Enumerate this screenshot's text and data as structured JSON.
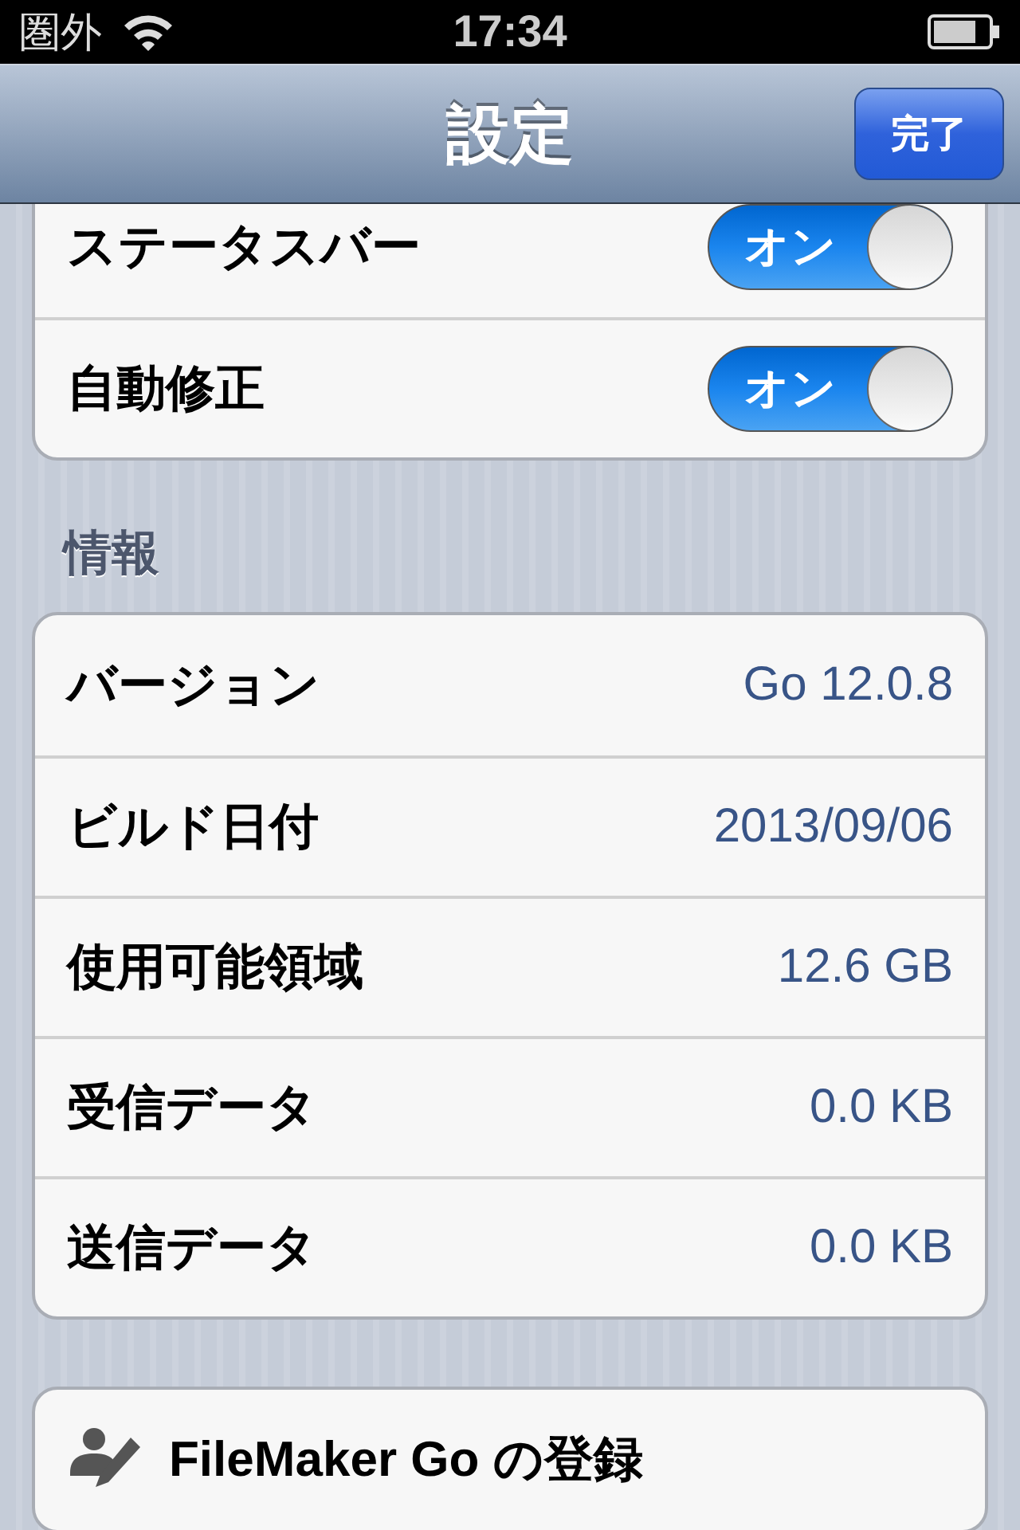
{
  "status_bar": {
    "carrier": "圏外",
    "time": "17:34"
  },
  "nav_bar": {
    "title": "設定",
    "done_button": "完了"
  },
  "toggles": [
    {
      "label": "ステータスバー",
      "on": true,
      "switch_label": "オン"
    },
    {
      "label": "自動修正",
      "on": true,
      "switch_label": "オン"
    }
  ],
  "info_section": {
    "header": "情報",
    "rows": [
      {
        "label": "バージョン",
        "value": "Go 12.0.8"
      },
      {
        "label": "ビルド日付",
        "value": "2013/09/06"
      },
      {
        "label": "使用可能領域",
        "value": "12.6 GB"
      },
      {
        "label": "受信データ",
        "value": "0.0 KB"
      },
      {
        "label": "送信データ",
        "value": "0.0 KB"
      }
    ]
  },
  "register_button": {
    "label": "FileMaker Go の登録"
  }
}
